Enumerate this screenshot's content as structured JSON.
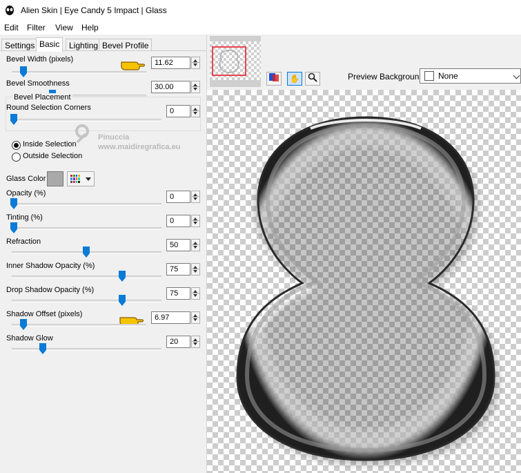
{
  "window": {
    "title": "Alien Skin | Eye Candy 5 Impact | Glass",
    "icon": "alien-skin-icon"
  },
  "menu": [
    "Edit",
    "Filter",
    "View",
    "Help"
  ],
  "tabs": [
    "Settings",
    "Basic",
    "Lighting",
    "Bevel Profile"
  ],
  "active_tab": "Basic",
  "controls": {
    "bevel_width": {
      "label": "Bevel Width (pixels)",
      "value": "11.62"
    },
    "bevel_smoothness": {
      "label": "Bevel Smoothness",
      "value": "30.00"
    },
    "round_corners": {
      "label": "Round Selection Corners",
      "value": "0"
    },
    "bevel_placement": {
      "title": "Bevel Placement",
      "inside": "Inside Selection",
      "outside": "Outside Selection",
      "selected": "inside"
    },
    "glass_color": {
      "label": "Glass Color",
      "color": "#a9a9a9"
    },
    "opacity": {
      "label": "Opacity (%)",
      "value": "0"
    },
    "tinting": {
      "label": "Tinting (%)",
      "value": "0"
    },
    "refraction": {
      "label": "Refraction",
      "value": "50"
    },
    "inner_shadow": {
      "label": "Inner Shadow Opacity (%)",
      "value": "75"
    },
    "drop_shadow": {
      "label": "Drop Shadow Opacity (%)",
      "value": "75"
    },
    "shadow_offset": {
      "label": "Shadow Offset (pixels)",
      "value": "6.97"
    },
    "shadow_glow": {
      "label": "Shadow Glow",
      "value": "20"
    }
  },
  "watermark": {
    "line1": "Pinuccia",
    "line2": "www.maidiregrafica.eu"
  },
  "preview": {
    "background_label": "Preview Background:",
    "background_value": "None"
  },
  "colors": {
    "accent": "#0a7bd6",
    "frame": "#e8434f"
  }
}
